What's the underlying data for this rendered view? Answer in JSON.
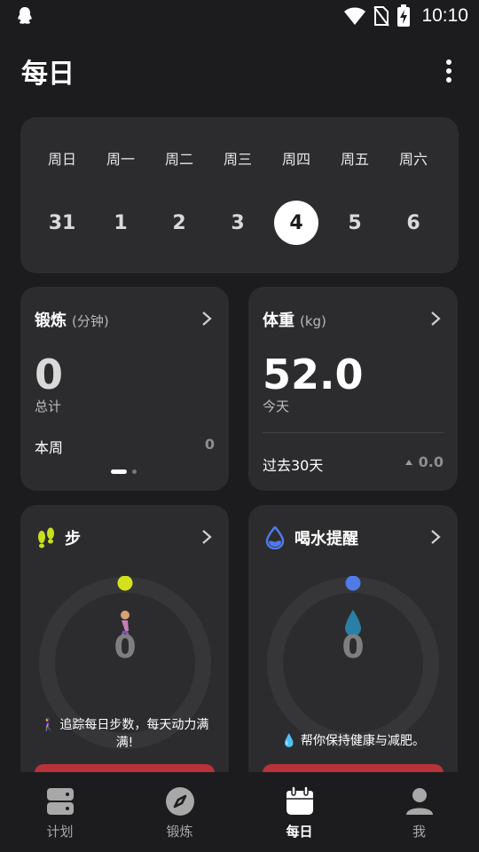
{
  "status_bar": {
    "time": "10:10"
  },
  "header": {
    "title": "每日"
  },
  "week": {
    "days": [
      {
        "label": "周日",
        "num": "31",
        "selected": false
      },
      {
        "label": "周一",
        "num": "1",
        "selected": false
      },
      {
        "label": "周二",
        "num": "2",
        "selected": false
      },
      {
        "label": "周三",
        "num": "3",
        "selected": false
      },
      {
        "label": "周四",
        "num": "4",
        "selected": true
      },
      {
        "label": "周五",
        "num": "5",
        "selected": false
      },
      {
        "label": "周六",
        "num": "6",
        "selected": false
      }
    ]
  },
  "exercise_card": {
    "title": "锻炼",
    "unit": "(分钟)",
    "value": "0",
    "value_label": "总计",
    "week_label": "本周",
    "week_value": "0"
  },
  "weight_card": {
    "title": "体重",
    "unit": "(kg)",
    "value": "52.0",
    "value_label": "今天",
    "past_label": "过去30天",
    "past_value": "0.0"
  },
  "steps_card": {
    "title": "步",
    "value": "0",
    "tip": "🚶‍♀️ 追踪每日步数，每天动力满满!",
    "accent": "#d4e21c",
    "progress": 0
  },
  "water_card": {
    "title": "喝水提醒",
    "value": "0",
    "tip": "💧 帮你保持健康与减肥。",
    "accent": "#4f7be6",
    "progress": 0
  },
  "bottom_nav": {
    "items": [
      {
        "label": "计划",
        "icon": "plan-icon",
        "active": false
      },
      {
        "label": "锻炼",
        "icon": "compass-icon",
        "active": false
      },
      {
        "label": "每日",
        "icon": "calendar-icon",
        "active": true
      },
      {
        "label": "我",
        "icon": "profile-icon",
        "active": false
      }
    ]
  }
}
